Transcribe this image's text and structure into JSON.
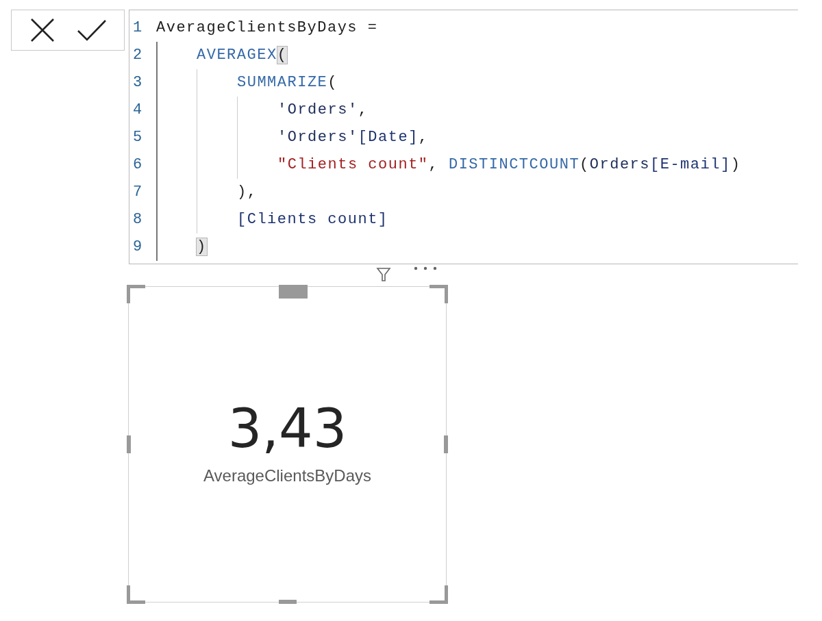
{
  "formula_bar": {
    "lines": [
      {
        "number": "1",
        "tokens": [
          {
            "kind": "text",
            "text": "AverageClientsByDays ="
          }
        ],
        "children": [
          {
            "number": "2",
            "tokens": [
              {
                "kind": "function",
                "text": "AVERAGEX"
              },
              {
                "kind": "match",
                "text": "("
              }
            ],
            "children": [
              {
                "number": "3",
                "tokens": [
                  {
                    "kind": "function",
                    "text": "SUMMARIZE"
                  },
                  {
                    "kind": "text",
                    "text": "("
                  }
                ],
                "children": [
                  {
                    "number": "4",
                    "tokens": [
                      {
                        "kind": "table",
                        "text": "'Orders'"
                      },
                      {
                        "kind": "text",
                        "text": ","
                      }
                    ]
                  },
                  {
                    "number": "5",
                    "tokens": [
                      {
                        "kind": "table",
                        "text": "'Orders'"
                      },
                      {
                        "kind": "column",
                        "text": "[Date]"
                      },
                      {
                        "kind": "text",
                        "text": ","
                      }
                    ]
                  },
                  {
                    "number": "6",
                    "tokens": [
                      {
                        "kind": "string",
                        "text": "\"Clients count\""
                      },
                      {
                        "kind": "text",
                        "text": ", "
                      },
                      {
                        "kind": "function",
                        "text": "DISTINCTCOUNT"
                      },
                      {
                        "kind": "text",
                        "text": "("
                      },
                      {
                        "kind": "table",
                        "text": "Orders"
                      },
                      {
                        "kind": "column",
                        "text": "[E-mail]"
                      },
                      {
                        "kind": "text",
                        "text": ")"
                      }
                    ]
                  }
                ]
              },
              {
                "number": "7",
                "tokens": [
                  {
                    "kind": "text",
                    "text": "),"
                  }
                ]
              },
              {
                "number": "8",
                "tokens": [
                  {
                    "kind": "column",
                    "text": "[Clients count]"
                  }
                ]
              }
            ]
          },
          {
            "number": "9",
            "tokens": [
              {
                "kind": "match",
                "text": ")"
              }
            ]
          }
        ]
      }
    ]
  },
  "card": {
    "selected": true,
    "value": "3,43",
    "label": "AverageClientsByDays"
  }
}
